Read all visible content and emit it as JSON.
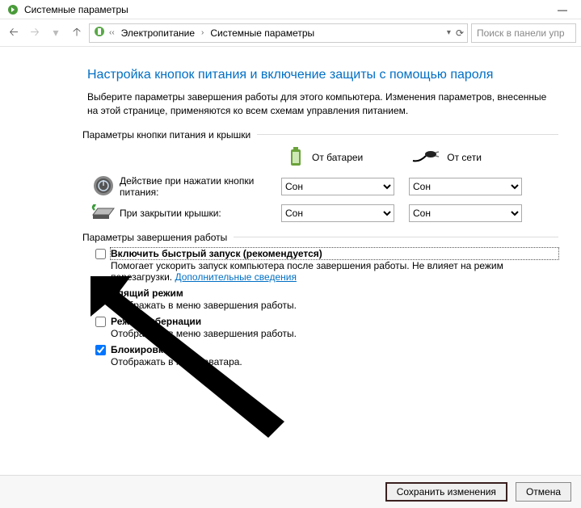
{
  "titlebar": {
    "title": "Системные параметры"
  },
  "nav": {
    "crumb1": "Электропитание",
    "crumb2": "Системные параметры",
    "search_placeholder": "Поиск в панели упр"
  },
  "heading": "Настройка кнопок питания и включение защиты с помощью пароля",
  "intro": "Выберите параметры завершения работы для этого компьютера. Изменения параметров, внесенные на этой странице, применяются ко всем схемам управления питанием.",
  "group_power": "Параметры кнопки питания и крышки",
  "col_battery": "От батареи",
  "col_ac": "От сети",
  "row_button": "Действие при нажатии кнопки питания:",
  "row_lid": "При закрытии крышки:",
  "sleep_value": "Сон",
  "group_shutdown": "Параметры завершения работы",
  "opts": {
    "fast": {
      "title": "Включить быстрый запуск (рекомендуется)",
      "desc_a": "Помогает ускорить запуск компьютера после завершения работы. Не влияет на режим перезагрузки. ",
      "link": "Дополнительные сведения"
    },
    "sleep": {
      "title": "Спящий режим",
      "desc": "Отображать в меню завершения работы."
    },
    "hiber": {
      "title": "Режим гибернации",
      "desc": "Отображать в меню завершения работы."
    },
    "lock": {
      "title": "Блокировка",
      "desc": "Отображать в меню аватара."
    }
  },
  "buttons": {
    "save": "Сохранить изменения",
    "cancel": "Отмена"
  }
}
